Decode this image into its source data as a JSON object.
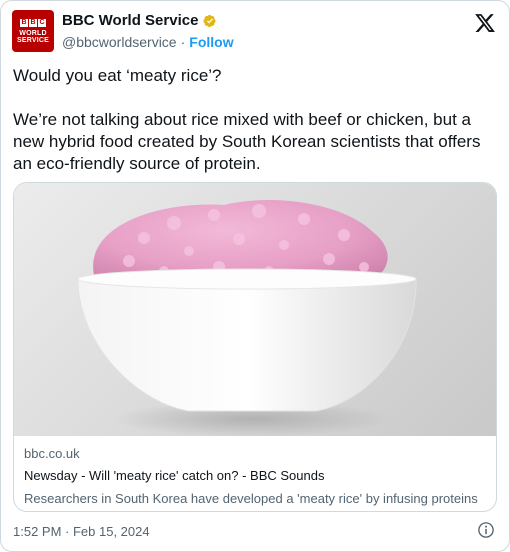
{
  "account": {
    "name": "BBC World Service",
    "handle": "@bbcworldservice",
    "separator": "·",
    "follow_label": "Follow",
    "avatar": {
      "blocks": [
        "B",
        "B",
        "C"
      ],
      "line1": "WORLD",
      "line2": "SERVICE",
      "color": "#b80000"
    },
    "verified_badge": "gold-verified-icon"
  },
  "tweet": {
    "line1": "Would you eat ‘meaty rice’?",
    "line2": "We’re not talking about rice mixed with beef or chicken, but a new hybrid food created by South Korean scientists that offers an eco-friendly source of protein."
  },
  "card": {
    "image": "bowl-of-pink-rice-image",
    "domain": "bbc.co.uk",
    "title": "Newsday - Will 'meaty rice' catch on? - BBC Sounds",
    "description": "Researchers in South Korea have developed a 'meaty rice' by infusing proteins"
  },
  "footer": {
    "timestamp": "1:52 PM · Feb 15, 2024",
    "info_icon": "info-icon"
  },
  "colors": {
    "text_primary": "#0f1419",
    "text_secondary": "#536471",
    "link_blue": "#1d9bf0",
    "border": "#cfd9de",
    "verified_gold": "#e2b719"
  }
}
